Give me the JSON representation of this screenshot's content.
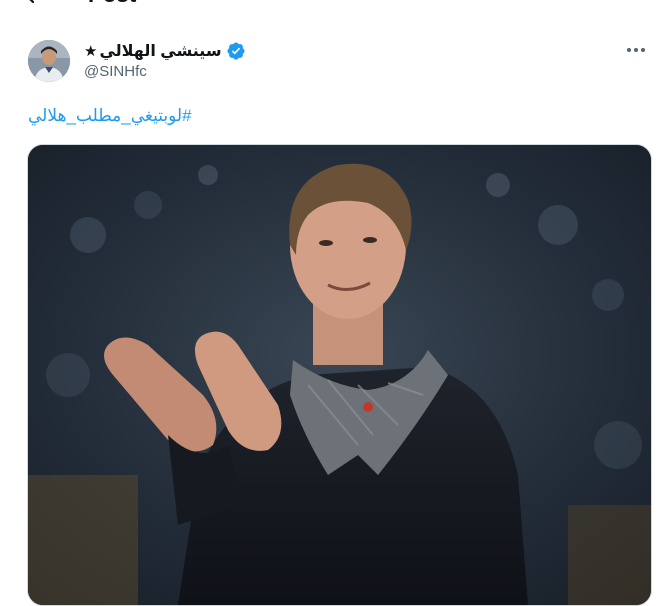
{
  "topbar": {
    "title": "Post"
  },
  "author": {
    "display_name": "سينشي الهلالي",
    "star": "★",
    "handle": "@SINHfc",
    "verified": true
  },
  "tweet": {
    "hashtag": "#لوبتيغي_مطلب_هلالي"
  },
  "colors": {
    "accent": "#1d9bf0",
    "secondary_text": "#536471",
    "primary_text": "#0f1419"
  },
  "icons": [
    "back-arrow-icon",
    "verified-badge-icon",
    "more-options-icon"
  ]
}
